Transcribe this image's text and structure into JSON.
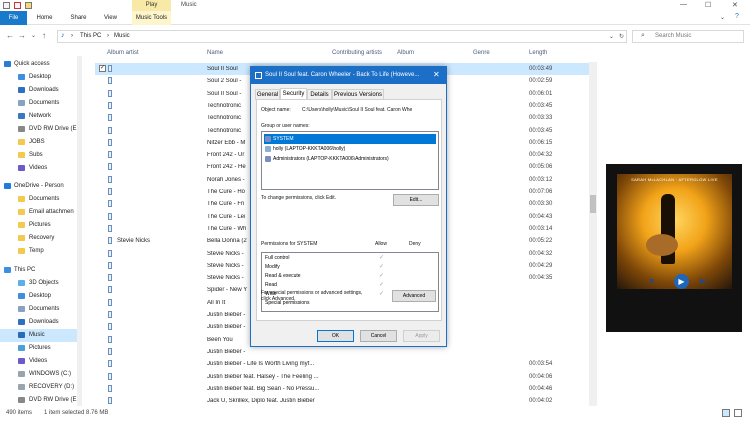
{
  "window": {
    "title": "Music",
    "contextual_tab": "Play",
    "controls": {
      "minimize": "—",
      "maximize": "☐",
      "close": "✕"
    }
  },
  "ribbon": {
    "tabs": [
      "File",
      "Home",
      "Share",
      "View",
      "Music Tools"
    ]
  },
  "address": {
    "back": "←",
    "forward": "→",
    "up_caret": "⌄",
    "up": "↑",
    "path": [
      "This PC",
      "Music"
    ],
    "separator": "›",
    "search_placeholder": "Search Music"
  },
  "sidebar": {
    "items": [
      {
        "label": "Quick access"
      },
      {
        "label": "Desktop"
      },
      {
        "label": "Downloads"
      },
      {
        "label": "Documents"
      },
      {
        "label": "Network"
      },
      {
        "label": "DVD RW Drive (E"
      },
      {
        "label": "JOBS"
      },
      {
        "label": "Subs"
      },
      {
        "label": "Videos"
      },
      {
        "label": "OneDrive - Person"
      },
      {
        "label": "Documents"
      },
      {
        "label": "Email attachmen"
      },
      {
        "label": "Pictures"
      },
      {
        "label": "Recovery"
      },
      {
        "label": "Temp"
      },
      {
        "label": "This PC"
      },
      {
        "label": "3D Objects"
      },
      {
        "label": "Desktop"
      },
      {
        "label": "Documents"
      },
      {
        "label": "Downloads"
      },
      {
        "label": "Music"
      },
      {
        "label": "Pictures"
      },
      {
        "label": "Videos"
      },
      {
        "label": "WINDOWS (C:)"
      },
      {
        "label": "RECOVERY (D:)"
      },
      {
        "label": "DVD RW Drive (E"
      }
    ]
  },
  "columns": {
    "album_artist": "Album artist",
    "name": "Name",
    "contributing_artists": "Contributing artists",
    "album": "Album",
    "genre": "Genre",
    "length": "Length"
  },
  "rows": [
    {
      "album_artist": "",
      "name": "Soul II Soul",
      "length": "00:03:49"
    },
    {
      "album_artist": "",
      "name": "Soul 2 Soul -",
      "length": "00:02:59"
    },
    {
      "album_artist": "",
      "name": "Soul II Soul -",
      "length": "00:06:01"
    },
    {
      "album_artist": "",
      "name": "Technotronic",
      "length": "00:03:45"
    },
    {
      "album_artist": "",
      "name": "Technotronic",
      "length": "00:03:33"
    },
    {
      "album_artist": "",
      "name": "Technotronic",
      "length": "00:03:45"
    },
    {
      "album_artist": "",
      "name": "Nitzer Ebb - M",
      "length": "00:06:15"
    },
    {
      "album_artist": "",
      "name": "Front 242 - Ur",
      "length": "00:04:32"
    },
    {
      "album_artist": "",
      "name": "Front 242 - He",
      "length": "00:05:06"
    },
    {
      "album_artist": "",
      "name": "Norah Jones -",
      "length": "00:03:12"
    },
    {
      "album_artist": "",
      "name": "The Cure - Ho",
      "length": "00:07:06"
    },
    {
      "album_artist": "",
      "name": "The Cure - Fri",
      "length": "00:03:30"
    },
    {
      "album_artist": "",
      "name": "The Cure - Lei",
      "length": "00:04:43"
    },
    {
      "album_artist": "",
      "name": "The Cure - Wh",
      "length": "00:03:14"
    },
    {
      "album_artist": "Stevie Nicks",
      "name": "Bella Donna (2",
      "length": "00:05:22"
    },
    {
      "album_artist": "",
      "name": "Stevie Nicks -",
      "length": "00:04:32"
    },
    {
      "album_artist": "",
      "name": "Stevie Nicks -",
      "length": "00:04:29"
    },
    {
      "album_artist": "",
      "name": "Stevie Nicks -",
      "length": "00:04:35"
    },
    {
      "album_artist": "",
      "name": "Spider - New Y",
      "length": ""
    },
    {
      "album_artist": "",
      "name": "All In It",
      "length": ""
    },
    {
      "album_artist": "",
      "name": "Justin Bieber -",
      "length": ""
    },
    {
      "album_artist": "",
      "name": "Justin Bieber -",
      "length": ""
    },
    {
      "album_artist": "",
      "name": "Been You",
      "length": ""
    },
    {
      "album_artist": "",
      "name": "Justin Bieber -",
      "length": ""
    },
    {
      "album_artist": "",
      "name": "Justin Bieber - Life Is Worth Living myf...",
      "length": "00:03:54"
    },
    {
      "album_artist": "",
      "name": "Justin Bieber feat. Halsey - The Feeling ...",
      "length": "00:04:06"
    },
    {
      "album_artist": "",
      "name": "Justin Bieber feat. Big Sean - No Pressu...",
      "length": "00:04:46"
    },
    {
      "album_artist": "",
      "name": "Jack Ü, Skrillex, Diplo feat. Justin Bieber",
      "length": "00:04:02"
    }
  ],
  "preview": {
    "cover_text": "SARAH McLACHLAN · AFTERGLOW LIVE",
    "player": {
      "stop": "■",
      "play": "▶",
      "next": "▶|"
    }
  },
  "status": {
    "items_count": "490 items",
    "selection": "1 item selected  8.76 MB"
  },
  "dialog": {
    "title": "Soul II Soul feat. Caron Wheeler - Back To Life (Howeve...",
    "close": "✕",
    "tabs": [
      "General",
      "Security",
      "Details",
      "Previous Versions"
    ],
    "object_name_label": "Object name:",
    "object_name_value": "C:\\Users\\holly\\Music\\Soul II Soul feat. Caron Whe",
    "group_label": "Group or user names:",
    "users": [
      "SYSTEM",
      "holly (LAPTOP-KKKTA006\\holly)",
      "Administrators (LAPTOP-KKKTA006\\Administrators)"
    ],
    "change_perm_text": "To change permissions, click Edit.",
    "edit_button": "Edit...",
    "permissions_for": "Permissions for SYSTEM",
    "allow_label": "Allow",
    "deny_label": "Deny",
    "permissions": [
      {
        "name": "Full control",
        "allow": "✓"
      },
      {
        "name": "Modify",
        "allow": "✓"
      },
      {
        "name": "Read & execute",
        "allow": "✓"
      },
      {
        "name": "Read",
        "allow": "✓"
      },
      {
        "name": "Write",
        "allow": "✓"
      },
      {
        "name": "Special permissions",
        "allow": ""
      }
    ],
    "special_text_1": "For special permissions or advanced settings,",
    "special_text_2": "click Advanced.",
    "advanced_button": "Advanced",
    "ok_button": "OK",
    "cancel_button": "Cancel",
    "apply_button": "Apply"
  }
}
